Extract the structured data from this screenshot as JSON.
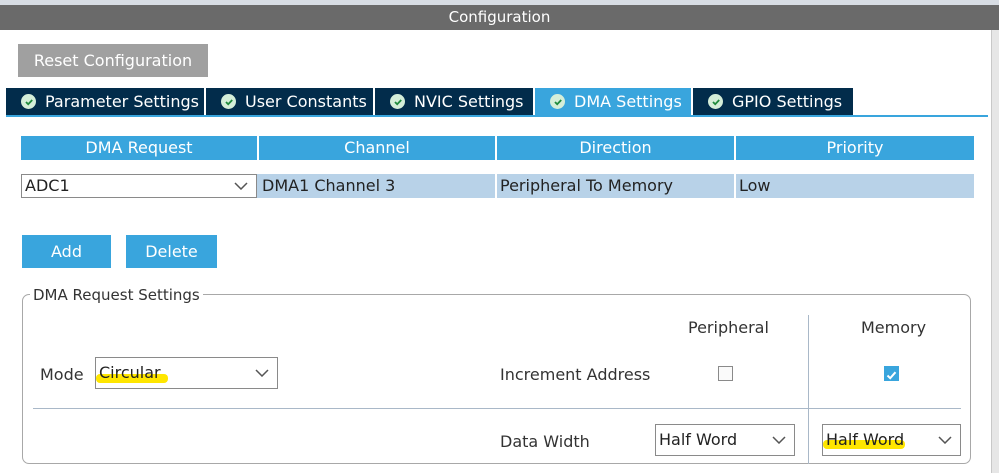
{
  "window": {
    "title": "Configuration"
  },
  "toolbar": {
    "reset_label": "Reset Configuration"
  },
  "tabs": [
    {
      "label": "Parameter Settings",
      "active": false
    },
    {
      "label": "User Constants",
      "active": false
    },
    {
      "label": "NVIC Settings",
      "active": false
    },
    {
      "label": "DMA Settings",
      "active": true
    },
    {
      "label": "GPIO Settings",
      "active": false
    }
  ],
  "dma_table": {
    "headers": [
      "DMA Request",
      "Channel",
      "Direction",
      "Priority"
    ],
    "rows": [
      {
        "request": "ADC1",
        "channel": "DMA1 Channel 3",
        "direction": "Peripheral To Memory",
        "priority": "Low"
      }
    ]
  },
  "actions": {
    "add_label": "Add",
    "delete_label": "Delete"
  },
  "request_settings": {
    "group_title": "DMA Request Settings",
    "mode_label": "Mode",
    "mode_value": "Circular",
    "peripheral_header": "Peripheral",
    "memory_header": "Memory",
    "increment_label": "Increment Address",
    "peripheral_increment": false,
    "memory_increment": true,
    "data_width_label": "Data Width",
    "peripheral_data_width": "Half Word",
    "memory_data_width": "Half Word"
  },
  "colors": {
    "accent": "#39a5dd",
    "tab_dark": "#022c4b",
    "title_bar": "#6a6a6a",
    "row_selected": "#b8d2e8",
    "highlight": "#ffe600"
  },
  "icons": {
    "tab_status": "check-circle-icon",
    "dropdown": "chevron-down-icon",
    "checkbox": "checkmark-icon"
  }
}
